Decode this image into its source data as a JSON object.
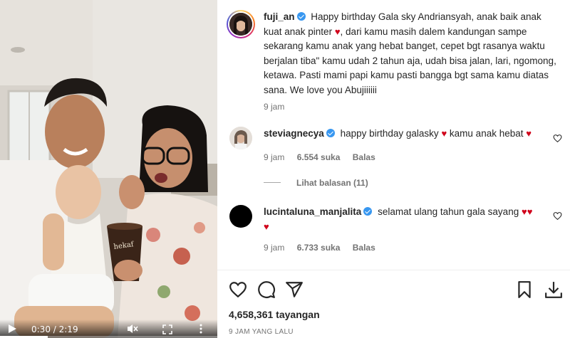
{
  "video": {
    "current_time": "0:30",
    "duration": "2:19",
    "time_separator": " / ",
    "progress": 0.22,
    "cup_text": "hekaf"
  },
  "post": {
    "username": "fuji_an",
    "caption": "Happy birthday Gala sky Andriansyah, anak baik anak kuat anak pinter",
    "caption_rest": ", dari kamu masih dalem kandungan sampe sekarang kamu anak yang hebat banget, cepet bgt rasanya waktu berjalan tiba\" kamu udah 2 tahun aja, udah bisa jalan, lari, ngomong, ketawa. Pasti mami papi kamu pasti bangga bgt sama kamu diatas sana. We love you Abujiiiiii",
    "time": "9 jam"
  },
  "comments": [
    {
      "username": "steviagnecya",
      "text": "happy birthday galasky",
      "text_after": "kamu anak hebat",
      "time": "9 jam",
      "likes": "6.554 suka",
      "reply_label": "Balas",
      "view_replies": "Lihat balasan (11)"
    },
    {
      "username": "lucintaluna_manjalita",
      "text": "selamat ulang tahun gala sayang",
      "time": "9 jam",
      "likes": "6.733 suka",
      "reply_label": "Balas"
    }
  ],
  "stats": {
    "views": "4,658,361 tayangan",
    "posted_ago": "9 JAM YANG LALU"
  },
  "colors": {
    "heart": "#d0021b",
    "verified": "#3897f0",
    "muted_text": "#737373"
  },
  "icons": [
    "play-icon",
    "mute-icon",
    "fullscreen-icon",
    "more-icon",
    "heart-icon",
    "comment-icon",
    "share-icon",
    "bookmark-icon",
    "download-icon"
  ]
}
